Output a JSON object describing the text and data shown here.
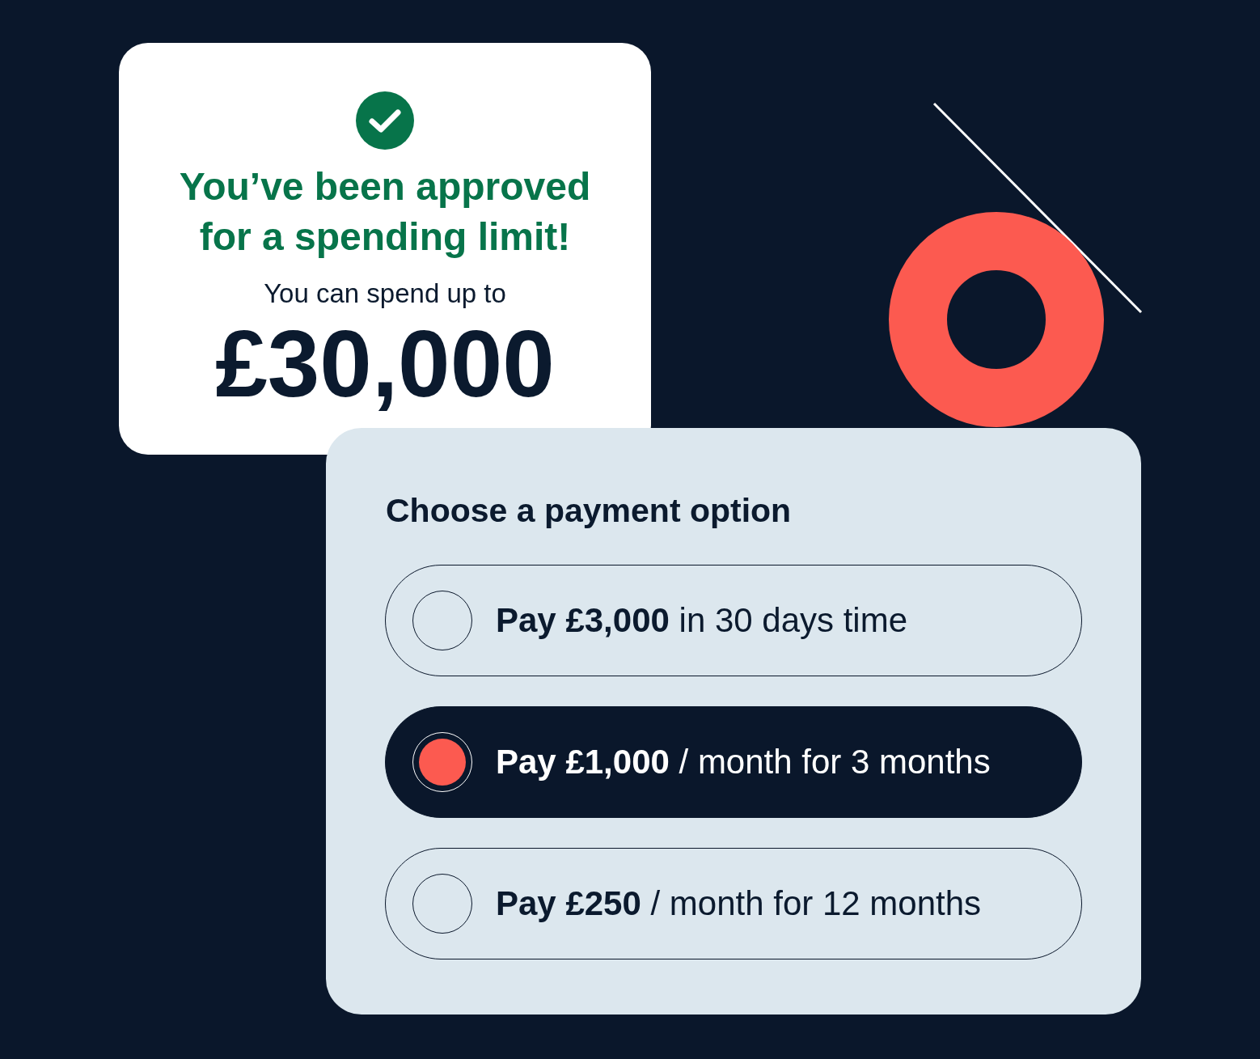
{
  "approval_card": {
    "title": "You’ve been approved for a spending limit!",
    "subtitle": "You can spend up to",
    "amount": "£30,000"
  },
  "payment_panel": {
    "heading": "Choose a payment option",
    "options": [
      {
        "label": "**Pay £3,000** in 30 days time",
        "selected": false
      },
      {
        "label": "**Pay £1,000** / month for 3 months",
        "selected": true
      },
      {
        "label": "**Pay £250** / month for 12 months",
        "selected": false
      }
    ]
  }
}
